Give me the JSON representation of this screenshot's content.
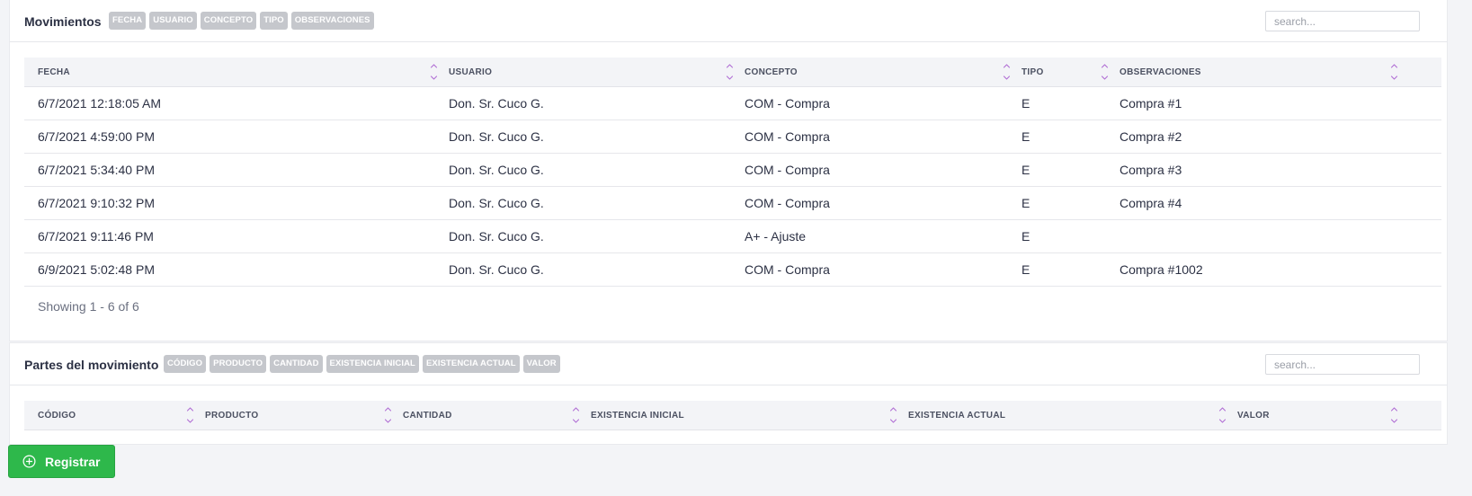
{
  "movements": {
    "title": "Movimientos",
    "chips": [
      "FECHA",
      "USUARIO",
      "CONCEPTO",
      "TIPO",
      "OBSERVACIONES"
    ],
    "search_placeholder": "search...",
    "columns": [
      "FECHA",
      "USUARIO",
      "CONCEPTO",
      "TIPO",
      "OBSERVACIONES"
    ],
    "rows": [
      {
        "fecha": "6/7/2021 12:18:05 AM",
        "usuario": "Don. Sr. Cuco G.",
        "concepto": "COM - Compra",
        "tipo": "E",
        "observaciones": "Compra #1"
      },
      {
        "fecha": "6/7/2021 4:59:00 PM",
        "usuario": "Don. Sr. Cuco G.",
        "concepto": "COM - Compra",
        "tipo": "E",
        "observaciones": "Compra #2"
      },
      {
        "fecha": "6/7/2021 5:34:40 PM",
        "usuario": "Don. Sr. Cuco G.",
        "concepto": "COM - Compra",
        "tipo": "E",
        "observaciones": "Compra #3"
      },
      {
        "fecha": "6/7/2021 9:10:32 PM",
        "usuario": "Don. Sr. Cuco G.",
        "concepto": "COM - Compra",
        "tipo": "E",
        "observaciones": "Compra #4"
      },
      {
        "fecha": "6/7/2021 9:11:46 PM",
        "usuario": "Don. Sr. Cuco G.",
        "concepto": "A+ - Ajuste",
        "tipo": "E",
        "observaciones": ""
      },
      {
        "fecha": "6/9/2021 5:02:48 PM",
        "usuario": "Don. Sr. Cuco G.",
        "concepto": "COM - Compra",
        "tipo": "E",
        "observaciones": "Compra #1002"
      }
    ],
    "footer": "Showing 1 - 6 of 6"
  },
  "parts": {
    "title": "Partes del movimiento",
    "chips": [
      "CÓDIGO",
      "PRODUCTO",
      "CANTIDAD",
      "EXISTENCIA INICIAL",
      "EXISTENCIA ACTUAL",
      "VALOR"
    ],
    "search_placeholder": "search...",
    "columns": [
      "CÓDIGO",
      "PRODUCTO",
      "CANTIDAD",
      "EXISTENCIA INICIAL",
      "EXISTENCIA ACTUAL",
      "VALOR"
    ]
  },
  "register_button": {
    "label": "Registrar",
    "icon": "plus-circle-icon"
  },
  "colors": {
    "accent_green": "#2eb84b",
    "chip_gray": "#c5c7cc",
    "sort_icon_purple": "#b16fd4"
  }
}
